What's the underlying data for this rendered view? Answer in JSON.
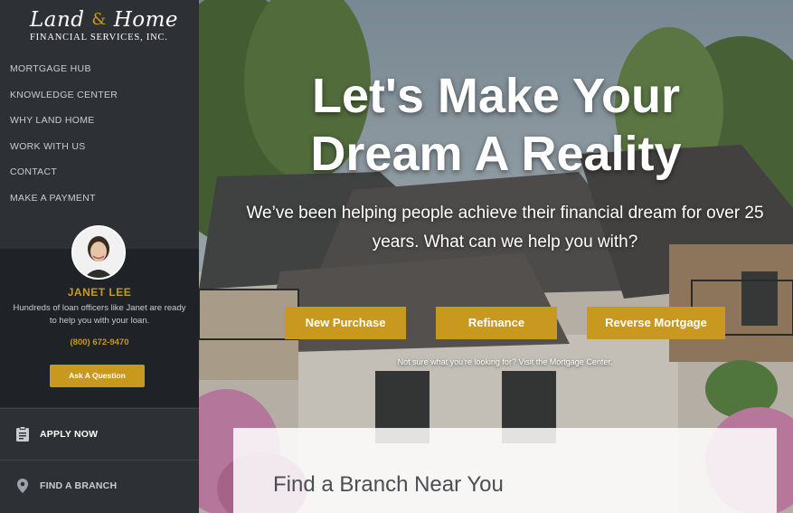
{
  "brand": {
    "logo_script_left": "Land",
    "logo_script_amp": "&",
    "logo_script_right": "Home",
    "logo_sub": "FINANCIAL SERVICES, INC.",
    "accent": "#c9981e"
  },
  "nav": {
    "items": [
      {
        "label": "MORTGAGE HUB"
      },
      {
        "label": "KNOWLEDGE CENTER"
      },
      {
        "label": "WHY LAND HOME"
      },
      {
        "label": "WORK WITH US"
      },
      {
        "label": "CONTACT"
      },
      {
        "label": "MAKE A PAYMENT"
      }
    ]
  },
  "agent": {
    "name": "JANET LEE",
    "description": "Hundreds of loan officers like Janet are ready to help you with your loan.",
    "phone": "(800) 672-9470",
    "ask_label": "Ask A Question"
  },
  "actions": {
    "apply": {
      "label": "APPLY NOW",
      "icon": "clipboard-icon"
    },
    "branch": {
      "label": "FIND A BRANCH",
      "icon": "location-pin-icon"
    }
  },
  "hero": {
    "title_line1": "Let's Make Your",
    "title_line2": "Dream A Reality",
    "subtitle": "We’ve been helping people achieve their financial dream for over 25 years. What can we help you with?",
    "buttons": [
      {
        "label": "New Purchase"
      },
      {
        "label": "Refinance"
      },
      {
        "label": "Reverse Mortgage"
      }
    ],
    "note": "Not sure what you're looking for? Visit the Mortgage Center."
  },
  "branch_card": {
    "title": "Find a Branch Near You"
  }
}
